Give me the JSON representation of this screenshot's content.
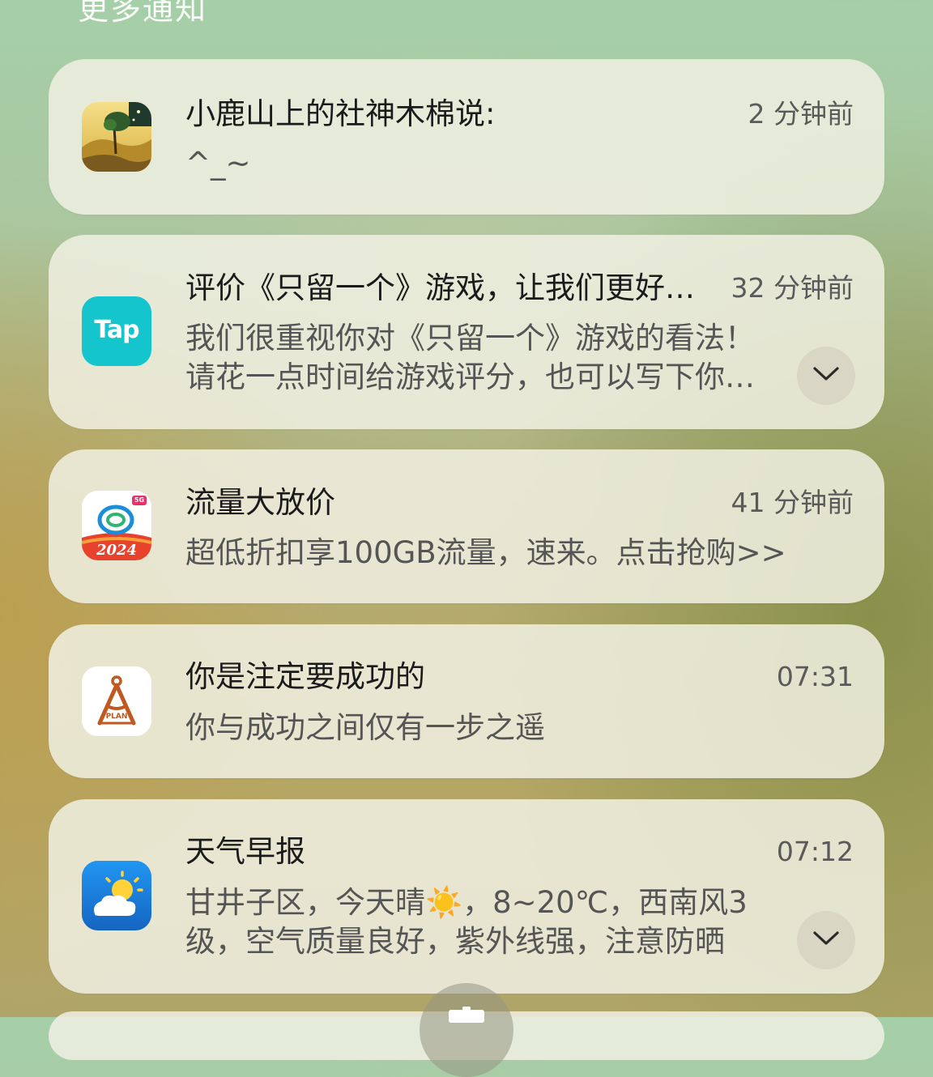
{
  "section": {
    "title": "更多通知"
  },
  "notifications": [
    {
      "app_icon": "deer-mountain-tree-icon",
      "title": "小鹿山上的社神木棉说:",
      "time": "2 分钟前",
      "body": "^_~",
      "expandable": false
    },
    {
      "app_icon": "taptap-icon",
      "app_icon_text": "Tap",
      "title": "评价《只留一个》游戏，让我们更好地了解你的喜好",
      "time": "32 分钟前",
      "body": "我们很重视你对《只留一个》游戏的看法！请花一点时间给游戏评分，也可以写下你的评价",
      "expandable": true
    },
    {
      "app_icon": "china-mobile-icon",
      "app_icon_badge": "5G",
      "app_icon_year": "2024",
      "title": "流量大放价",
      "time": "41 分钟前",
      "body": "超低折扣享100GB流量，速来。点击抢购>>",
      "expandable": false
    },
    {
      "app_icon": "compass-plan-icon",
      "app_icon_text": "PLAN",
      "title": "你是注定要成功的",
      "time": "07:31",
      "body": "你与成功之间仅有一步之遥",
      "expandable": false
    },
    {
      "app_icon": "weather-sun-cloud-icon",
      "title": "天气早报",
      "time": "07:12",
      "body": "甘井子区，今天晴☀️，8~20℃，西南风3级，空气质量良好，紫外线强，注意防晒",
      "expandable": true
    }
  ],
  "colors": {
    "card_bg": "#f0f0e2",
    "tap_brand": "#15c5ce",
    "weather_brand": "#1e88e5",
    "plan_brand": "#c0581f",
    "mobile_brand": "#e8412c"
  }
}
